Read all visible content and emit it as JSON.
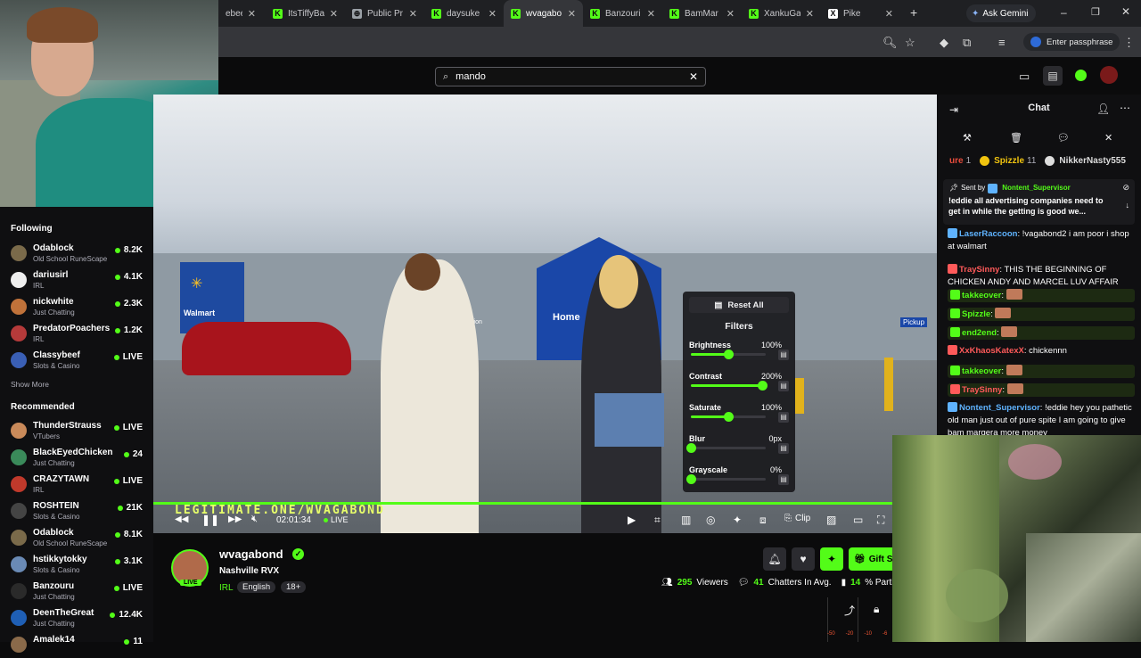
{
  "browser": {
    "tabs": [
      {
        "label": "ebeec",
        "fav_color": "#888888"
      },
      {
        "label": "ItsTiffyBa",
        "fav_color": "#53fc18",
        "fav_letter": "K"
      },
      {
        "label": "Public Pr",
        "fav_color": "#9aa0a6",
        "fav_letter": "⊕"
      },
      {
        "label": "daysuke",
        "fav_color": "#53fc18",
        "fav_letter": "K"
      },
      {
        "label": "wvagabo",
        "fav_color": "#53fc18",
        "fav_letter": "K",
        "active": true
      },
      {
        "label": "Banzouri",
        "fav_color": "#53fc18",
        "fav_letter": "K"
      },
      {
        "label": "BamMar",
        "fav_color": "#53fc18",
        "fav_letter": "K"
      },
      {
        "label": "XankuGa",
        "fav_color": "#53fc18",
        "fav_letter": "K"
      },
      {
        "label": "Pike",
        "fav_color": "#ffffff",
        "fav_letter": "X"
      }
    ],
    "ask_gemini": "Ask Gemini",
    "passphrase": "Enter passphrase"
  },
  "search": {
    "value": "mando"
  },
  "sidebar": {
    "following_title": "Following",
    "following": [
      {
        "name": "Odablock",
        "category": "Old School RuneScape",
        "viewers": "8.2K",
        "color": "#7a6a4a"
      },
      {
        "name": "dariusirl",
        "category": "IRL",
        "viewers": "4.1K",
        "color": "#eeeeee"
      },
      {
        "name": "nickwhite",
        "category": "Just Chatting",
        "viewers": "2.3K",
        "color": "#c0723a"
      },
      {
        "name": "PredatorPoachers",
        "category": "IRL",
        "viewers": "1.2K",
        "color": "#b53a3a"
      },
      {
        "name": "Classybeef",
        "category": "Slots & Casino",
        "viewers": "LIVE",
        "color": "#3a5fb5"
      }
    ],
    "show_more": "Show More",
    "recommended_title": "Recommended",
    "recommended": [
      {
        "name": "ThunderStrauss",
        "category": "VTubers",
        "viewers": "LIVE",
        "color": "#c98a5a"
      },
      {
        "name": "BlackEyedChicken",
        "category": "Just Chatting",
        "viewers": "24",
        "color": "#3a8a5a"
      },
      {
        "name": "CRAZYTAWN",
        "category": "IRL",
        "viewers": "LIVE",
        "color": "#c0392b"
      },
      {
        "name": "ROSHTEIN",
        "category": "Slots & Casino",
        "viewers": "21K",
        "color": "#444444"
      },
      {
        "name": "Odablock",
        "category": "Old School RuneScape",
        "viewers": "8.1K",
        "color": "#7a6a4a"
      },
      {
        "name": "hstikkytokky",
        "category": "Slots & Casino",
        "viewers": "3.1K",
        "color": "#6a8ab5"
      },
      {
        "name": "Banzouru",
        "category": "Just Chatting",
        "viewers": "LIVE",
        "color": "#2a2a2a"
      },
      {
        "name": "DeenTheGreat",
        "category": "Just Chatting",
        "viewers": "12.4K",
        "color": "#1f5fb5"
      },
      {
        "name": "Amalek14",
        "category": "",
        "viewers": "11",
        "color": "#8a6a4a"
      }
    ]
  },
  "video": {
    "overlay_text": "LEGITIMATE.ONE/WVAGABOND",
    "time": "02:01:34",
    "live_label": "LIVE",
    "clip_label": "Clip",
    "store_signs": [
      "Walmart",
      "Home",
      "Vision",
      "Pickup"
    ]
  },
  "filters": {
    "reset_label": "Reset All",
    "title": "Filters",
    "items": [
      {
        "label": "Brightness",
        "value": "100%",
        "level": 0.5
      },
      {
        "label": "Contrast",
        "value": "200%",
        "level": 0.95
      },
      {
        "label": "Saturate",
        "value": "100%",
        "level": 0.5
      },
      {
        "label": "Blur",
        "value": "0px",
        "level": 0.0
      },
      {
        "label": "Grayscale",
        "value": "0%",
        "level": 0.0
      }
    ]
  },
  "channel": {
    "name": "wvagabond",
    "title": "Nashville RVX",
    "category": "IRL",
    "tags": [
      "English",
      "18+"
    ],
    "live_badge": "LIVE",
    "viewers": "295",
    "viewers_label": "Viewers",
    "chatters": "41",
    "chatters_label": "Chatters In Avg.",
    "pct": "14",
    "pct_label": "% Partic",
    "gift_label": "Gift S"
  },
  "chat": {
    "title": "Chat",
    "top_gifters": [
      {
        "name": "ure",
        "count": "1",
        "color": "#e74c3c"
      },
      {
        "name": "Spizzle",
        "count": "11",
        "color": "#f1c40f"
      },
      {
        "name": "NikkerNasty555",
        "count": "",
        "color": "#dddddd"
      }
    ],
    "pinned": {
      "sent_by_label": "Sent by",
      "sender": "Nontent_Supervisor",
      "text": "!eddie all advertising companies need to get in while the getting is good we..."
    },
    "messages": [
      {
        "user": "LaserRaccoon",
        "color": "#5fb3ff",
        "text": "!vagabond2 i am poor i shop at walmart"
      },
      {
        "user": "TraySinny",
        "color": "#ff5a5a",
        "text": "THIS THE BEGINNING OF CHICKEN ANDY AND MARCEL LUV AFFAIR"
      },
      {
        "user": "takkeover",
        "color": "#53fc18",
        "text": ""
      },
      {
        "user": "Spizzle",
        "color": "#53fc18",
        "text": ""
      },
      {
        "user": "end2end",
        "color": "#53fc18",
        "text": ""
      },
      {
        "user": "XxKhaosKatexX",
        "color": "#ff5a5a",
        "text": "chickennn"
      },
      {
        "user": "takkeover",
        "color": "#53fc18",
        "text": ""
      },
      {
        "user": "TraySinny",
        "color": "#ff5a5a",
        "text": ""
      },
      {
        "user": "Nontent_Supervisor",
        "color": "#5fb3ff",
        "text": "!eddie hey you pathetic old man just out of pure spite I am going to give bam margera more money"
      }
    ]
  },
  "pond": {
    "meter_labels": [
      "-50",
      "-20",
      "-10",
      "-6"
    ]
  }
}
